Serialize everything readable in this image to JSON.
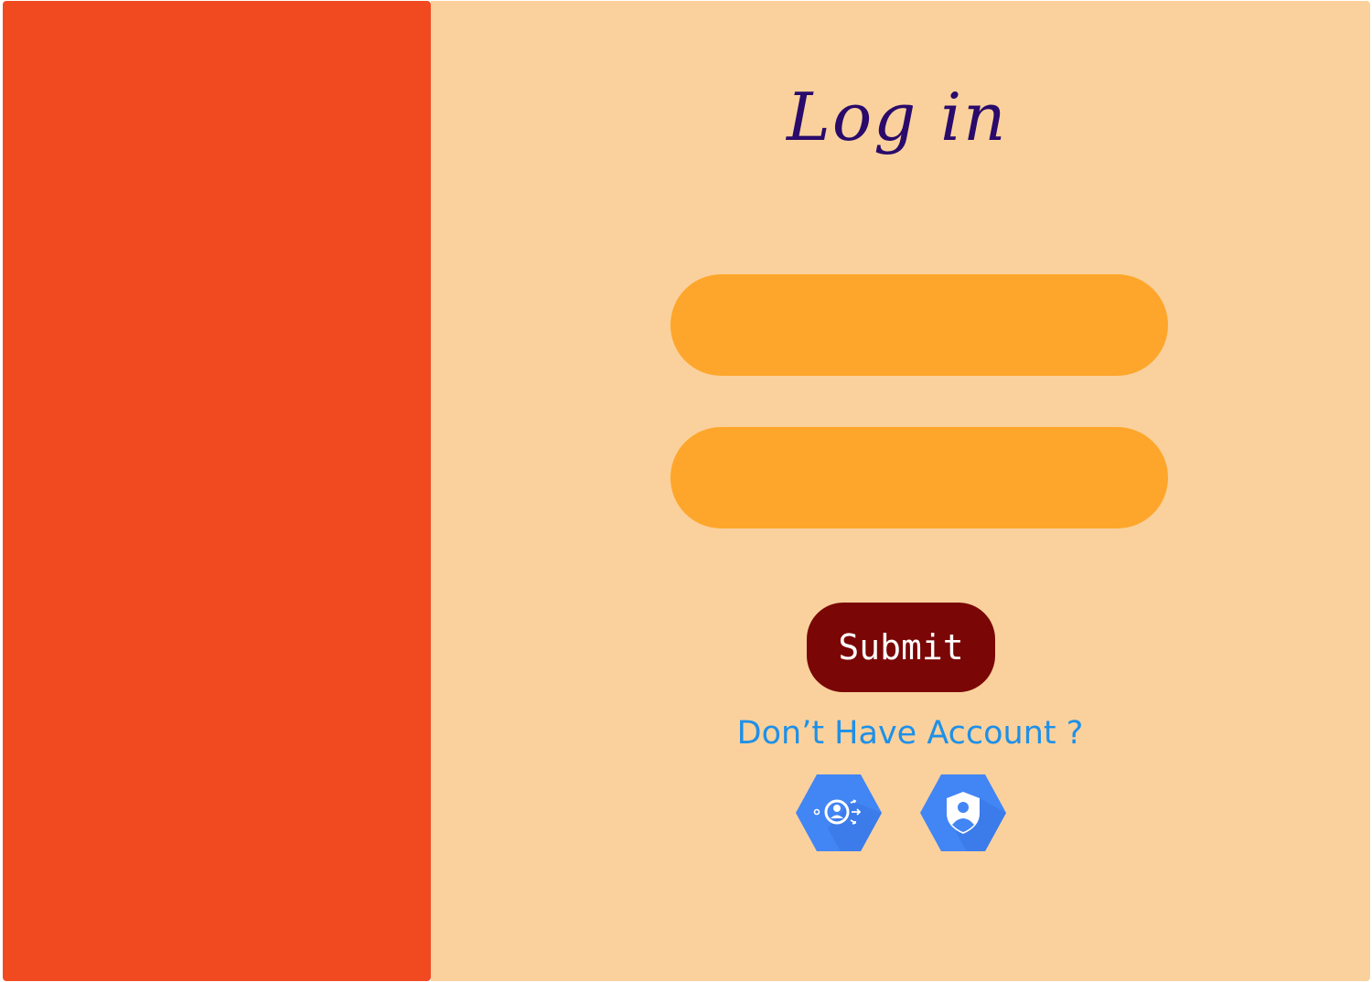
{
  "login": {
    "title": "Log in",
    "email_value": "",
    "password_value": "",
    "submit_label": "Submit",
    "signup_link": "Don’t Have Account ?"
  },
  "social_icons": [
    {
      "icon": "identity-transfer-icon"
    },
    {
      "icon": "identity-shield-icon"
    }
  ],
  "colors": {
    "left_panel": "#f14a21",
    "right_panel": "#fad19c",
    "input_fill": "#fea62b",
    "title": "#2a0a6b",
    "submit_bg": "#7a0606",
    "link": "#1e90e8",
    "icon_blue": "#4285f4"
  }
}
